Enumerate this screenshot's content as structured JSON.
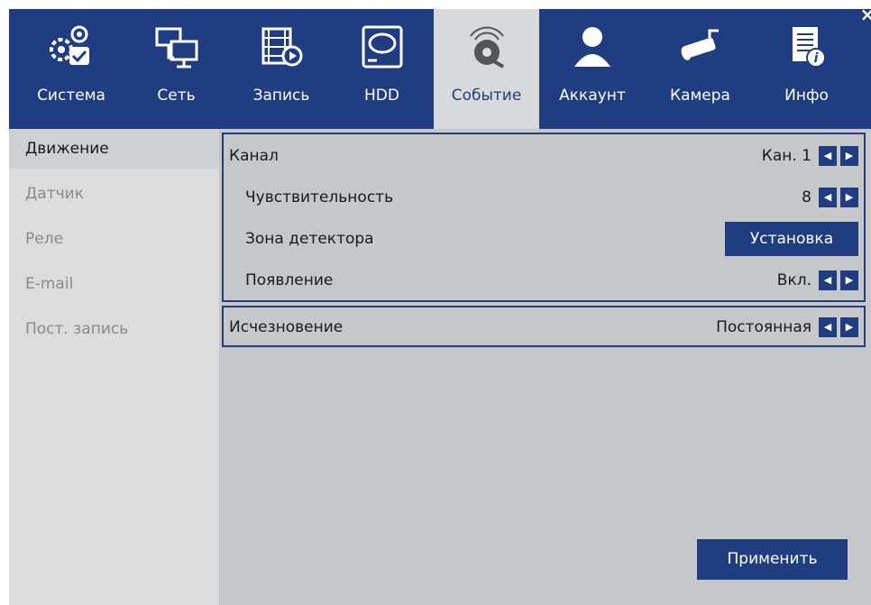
{
  "window": {
    "close_glyph": "×"
  },
  "tabs": [
    {
      "label": "Система",
      "icon": "system-gear-icon"
    },
    {
      "label": "Сеть",
      "icon": "network-icon"
    },
    {
      "label": "Запись",
      "icon": "record-film-icon"
    },
    {
      "label": "HDD",
      "icon": "hdd-icon"
    },
    {
      "label": "Событие",
      "icon": "event-alarm-icon",
      "active": true
    },
    {
      "label": "Аккаунт",
      "icon": "account-user-icon"
    },
    {
      "label": "Камера",
      "icon": "camera-icon"
    },
    {
      "label": "Инфо",
      "icon": "info-icon"
    }
  ],
  "sidebar": {
    "items": [
      {
        "label": "Движение",
        "active": true
      },
      {
        "label": "Датчик"
      },
      {
        "label": "Реле"
      },
      {
        "label": "E-mail"
      },
      {
        "label": "Пост. запись"
      }
    ]
  },
  "settings": {
    "channel": {
      "label": "Канал",
      "value": "Кан. 1"
    },
    "sensitivity": {
      "label": "Чувствительность",
      "value": "8"
    },
    "zone": {
      "label": "Зона детектора",
      "button": "Установка"
    },
    "appearance": {
      "label": "Появление",
      "value": "Вкл."
    },
    "disappearance": {
      "label": "Исчезновение",
      "value": "Постоянная"
    }
  },
  "arrows": {
    "left": "◀",
    "right": "▶"
  },
  "apply_button": "Применить",
  "colors": {
    "accent": "#1f3d80",
    "panel": "#c6c7c9",
    "sidebar": "#dcdcdc",
    "active_tab": "#d8d9db"
  }
}
